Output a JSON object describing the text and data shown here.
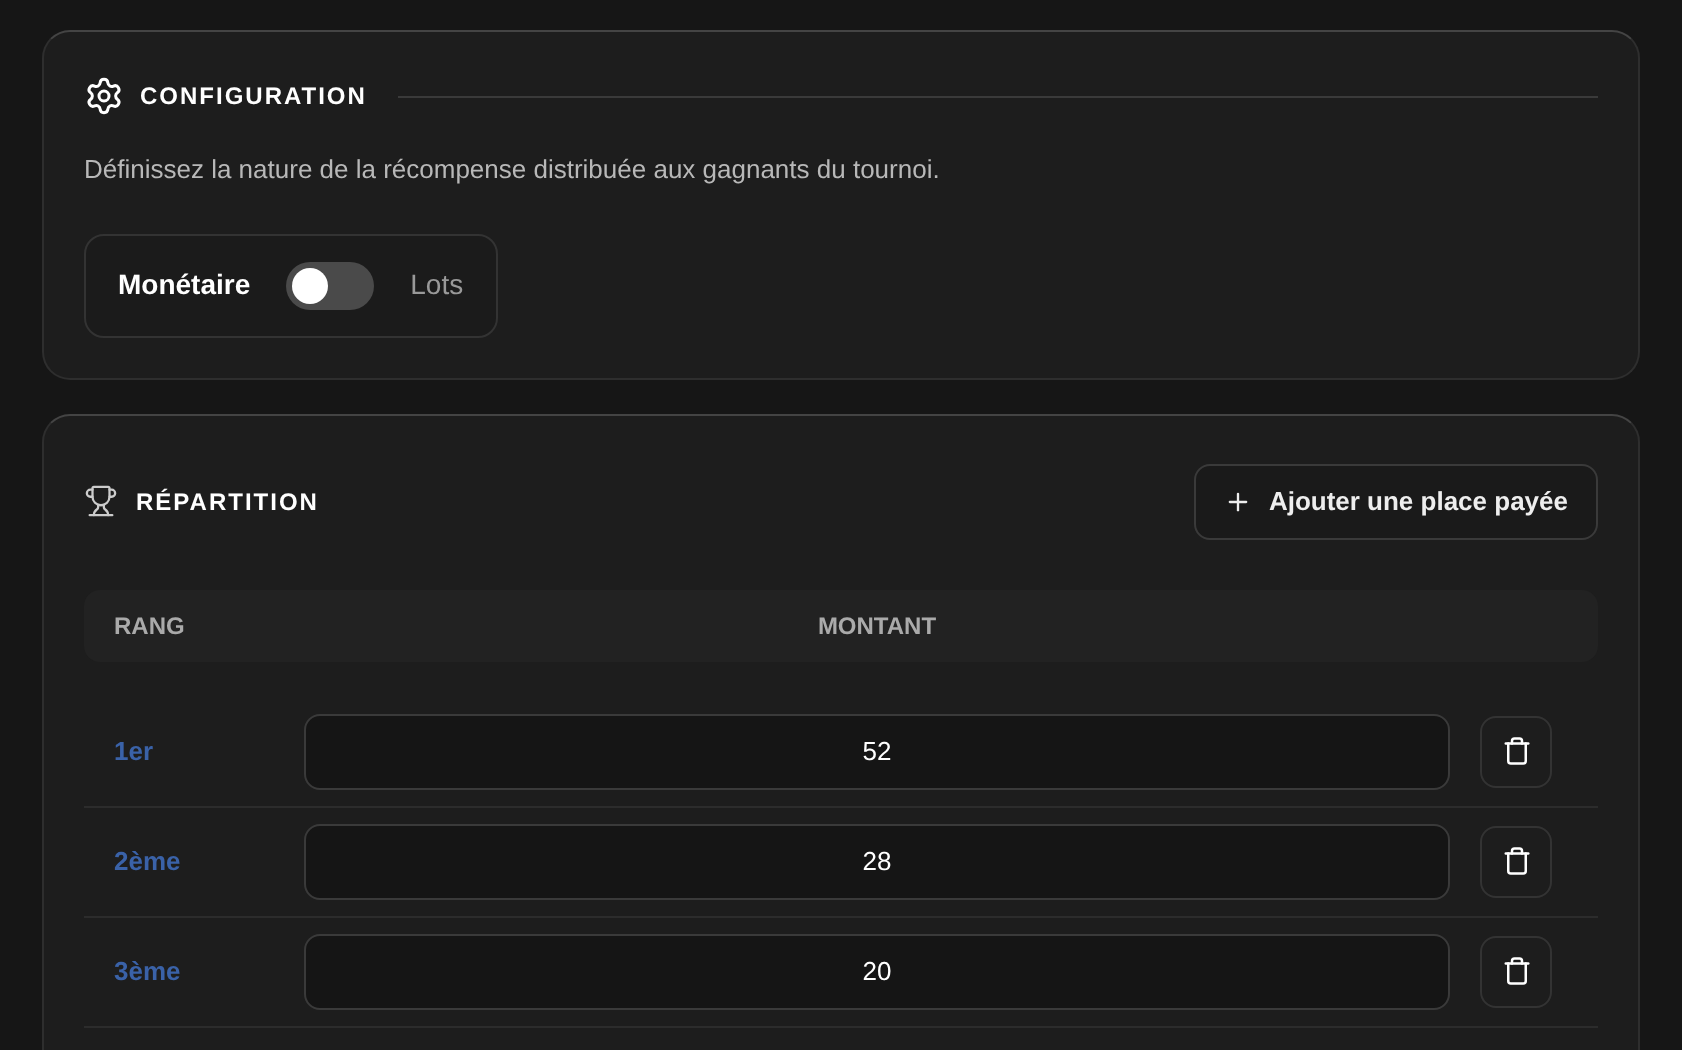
{
  "configuration": {
    "title": "CONFIGURATION",
    "description": "Définissez la nature de la récompense distribuée aux gagnants du tournoi.",
    "toggle": {
      "left_label": "Monétaire",
      "right_label": "Lots",
      "on": false
    }
  },
  "repartition": {
    "title": "RÉPARTITION",
    "add_button": "Ajouter une place payée",
    "columns": [
      "RANG",
      "MONTANT"
    ],
    "rows": [
      {
        "rank": "1er",
        "amount": "52"
      },
      {
        "rank": "2ème",
        "amount": "28"
      },
      {
        "rank": "3ème",
        "amount": "20"
      }
    ]
  }
}
